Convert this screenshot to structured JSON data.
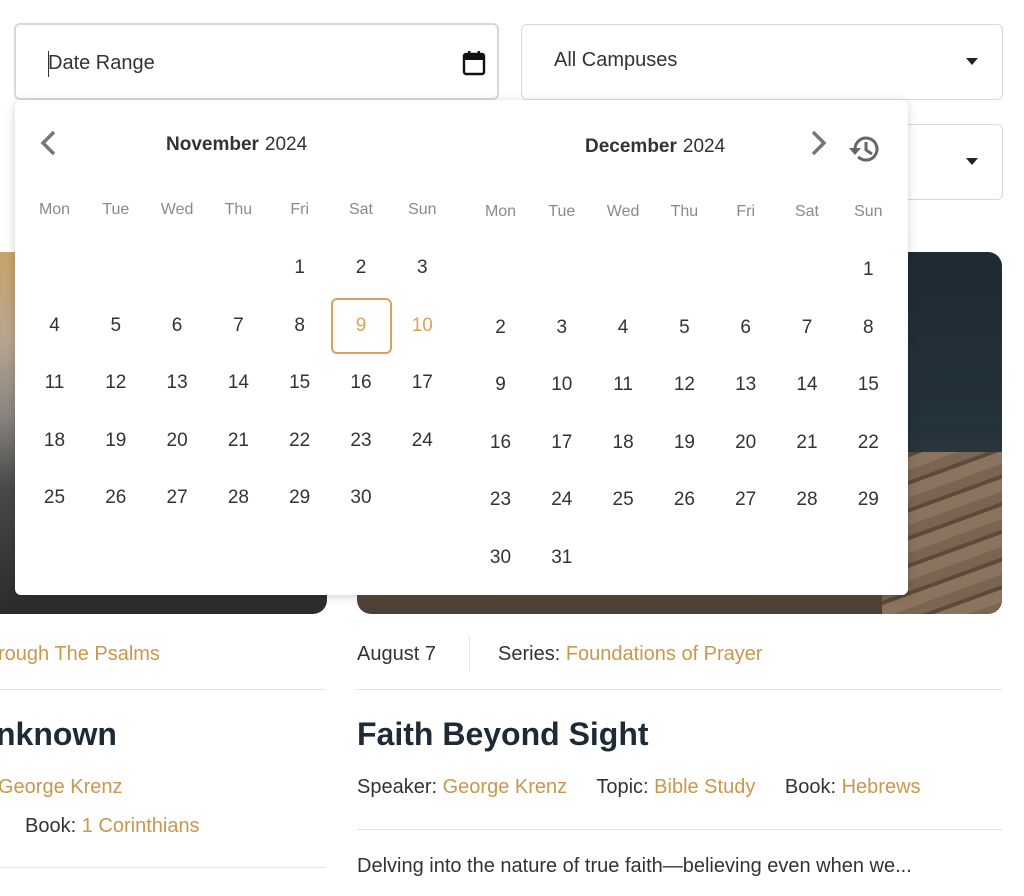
{
  "filters": {
    "date_range_placeholder": "Date Range",
    "campus_value": "All Campuses",
    "second_select_value": ""
  },
  "calendar": {
    "accent_color": "#d9a25a",
    "weekdays": [
      "Mon",
      "Tue",
      "Wed",
      "Thu",
      "Fri",
      "Sat",
      "Sun"
    ],
    "left": {
      "month": "November",
      "year": "2024",
      "start_weekday": 4,
      "days": 30,
      "selected_day": 9,
      "highlight_day": 10
    },
    "right": {
      "month": "December",
      "year": "2024",
      "start_weekday": 6,
      "days": 31
    }
  },
  "cards": {
    "left": {
      "series": "rough The Psalms",
      "title": "nknown",
      "speaker": "George Krenz",
      "book_label": "Book:",
      "book": "1 Corinthians"
    },
    "right": {
      "date": "August 7",
      "series_label": "Series:",
      "series": "Foundations of Prayer",
      "title": "Faith Beyond Sight",
      "speaker_label": "Speaker:",
      "speaker": "George Krenz",
      "topic_label": "Topic:",
      "topic": "Bible Study",
      "book_label": "Book:",
      "book": "Hebrews",
      "description": "Delving into the nature of true faith—believing even when we..."
    }
  }
}
